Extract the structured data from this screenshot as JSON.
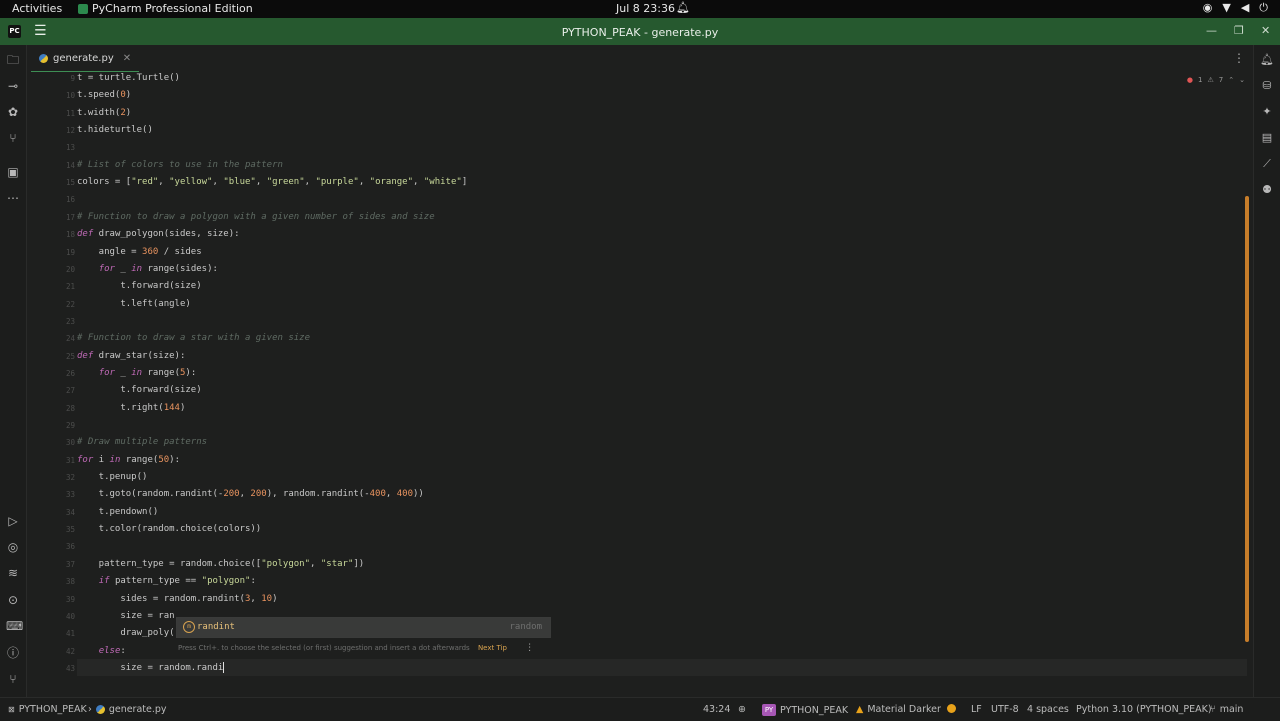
{
  "system_bar": {
    "activities": "Activities",
    "app_name": "PyCharm Professional Edition",
    "clock": "Jul 8  23:36"
  },
  "window": {
    "title": "PYTHON_PEAK - generate.py",
    "logo_text": "PC"
  },
  "tabs": [
    {
      "label": "generate.py",
      "active": true
    }
  ],
  "inspections": {
    "errors": "1",
    "warnings": "7"
  },
  "editor": {
    "lines": [
      {
        "n": "9",
        "html": "t = turtle.Turtle()"
      },
      {
        "n": "10",
        "html": "t.speed(<span class='num'>0</span>)"
      },
      {
        "n": "11",
        "html": "t.width(<span class='num'>2</span>)"
      },
      {
        "n": "12",
        "html": "t.hideturtle()"
      },
      {
        "n": "13",
        "html": ""
      },
      {
        "n": "14",
        "html": "<span class='cm'># List of colors to use in the pattern</span>"
      },
      {
        "n": "15",
        "html": "colors = [<span class='str'>\"red\"</span>, <span class='str'>\"yellow\"</span>, <span class='str'>\"blue\"</span>, <span class='str'>\"green\"</span>, <span class='str'>\"purple\"</span>, <span class='str'>\"orange\"</span>, <span class='str'>\"white\"</span>]"
      },
      {
        "n": "16",
        "html": ""
      },
      {
        "n": "17",
        "html": "<span class='cm'># Function to draw a polygon with a given number of sides and size</span>"
      },
      {
        "n": "18",
        "html": "<span class='kw'>def</span> draw_polygon(sides, size):"
      },
      {
        "n": "19",
        "html": "    angle = <span class='num'>360</span> / sides"
      },
      {
        "n": "20",
        "html": "    <span class='kw'>for</span> _ <span class='kw'>in</span> range(sides):"
      },
      {
        "n": "21",
        "html": "        t.forward(size)"
      },
      {
        "n": "22",
        "html": "        t.left(angle)"
      },
      {
        "n": "23",
        "html": ""
      },
      {
        "n": "24",
        "html": "<span class='cm'># Function to draw a star with a given size</span>"
      },
      {
        "n": "25",
        "html": "<span class='kw'>def</span> draw_star(size):"
      },
      {
        "n": "26",
        "html": "    <span class='kw'>for</span> _ <span class='kw'>in</span> range(<span class='num'>5</span>):"
      },
      {
        "n": "27",
        "html": "        t.forward(size)"
      },
      {
        "n": "28",
        "html": "        t.right(<span class='num'>144</span>)"
      },
      {
        "n": "29",
        "html": ""
      },
      {
        "n": "30",
        "html": "<span class='cm'># Draw multiple patterns</span>"
      },
      {
        "n": "31",
        "html": "<span class='kw'>for</span> i <span class='kw'>in</span> range(<span class='num'>50</span>):"
      },
      {
        "n": "32",
        "html": "    t.penup()"
      },
      {
        "n": "33",
        "html": "    t.goto(random.randint(-<span class='num'>200</span>, <span class='num'>200</span>), random.randint(-<span class='num'>400</span>, <span class='num'>400</span>))"
      },
      {
        "n": "34",
        "html": "    t.pendown()"
      },
      {
        "n": "35",
        "html": "    t.color(random.choice(colors))"
      },
      {
        "n": "36",
        "html": ""
      },
      {
        "n": "37",
        "html": "    pattern_type = random.choice([<span class='str'>\"polygon\"</span>, <span class='str'>\"star\"</span>])"
      },
      {
        "n": "38",
        "html": "    <span class='kw'>if</span> pattern_type == <span class='str'>\"polygon\"</span>:"
      },
      {
        "n": "39",
        "html": "        sides = random.randint(<span class='num'>3</span>, <span class='num'>10</span>)"
      },
      {
        "n": "40",
        "html": "        size = ran"
      },
      {
        "n": "41",
        "html": "        draw_poly("
      },
      {
        "n": "42",
        "html": "    <span class='kw'>else</span>:"
      },
      {
        "n": "43",
        "html": "        size = random.randi<span class='caret'></span>"
      }
    ]
  },
  "completion": {
    "item": "randint",
    "module": "random",
    "hint": "Press Ctrl+. to choose the selected (or first) suggestion and insert a dot afterwards",
    "next_tip": "Next Tip"
  },
  "status_bar": {
    "project": "PYTHON_PEAK",
    "file": "generate.py",
    "position": "43:24",
    "project_badge": "PY",
    "project_name": "PYTHON_PEAK",
    "theme": "Material Darker",
    "line_sep": "LF",
    "encoding": "UTF-8",
    "indent": "4 spaces",
    "interpreter": "Python 3.10 (PYTHON_PEAK)",
    "branch": "main"
  }
}
